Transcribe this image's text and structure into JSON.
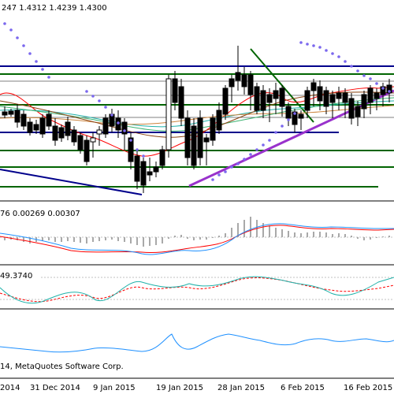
{
  "main_pane": {
    "ohlc_text": "247 1.4312 1.4239 1.4300"
  },
  "macd_pane": {
    "values_text": "76 0.00269 0.00307"
  },
  "stoch_pane": {
    "values_text": "49.3740"
  },
  "bottom_pane": {
    "copyright_text": "14, MetaQuotes Software Corp."
  },
  "x_axis": {
    "labels": [
      "2014",
      "31 Dec 2014",
      "9 Jan 2015",
      "19 Jan 2015",
      "28 Jan 2015",
      "6 Feb 2015",
      "16 Feb 2015"
    ]
  },
  "colors": {
    "background": "#ffffff",
    "navy_line": "#00008b",
    "green_line": "#006400",
    "gray_line": "#808080",
    "purple_trend": "#9932cc",
    "red_line": "#ff0000",
    "teal_line": "#20b2aa",
    "blue_line": "#1e90ff",
    "parabolic_sar": "#7b68ee"
  }
}
